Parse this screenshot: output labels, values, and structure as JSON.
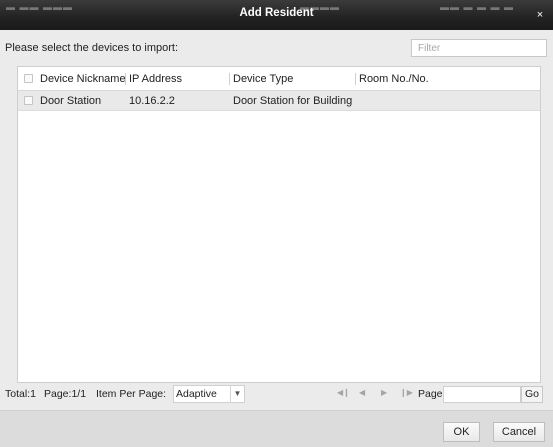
{
  "window": {
    "title": "Add Resident",
    "close_glyph": "×"
  },
  "prompt": "Please select the devices to import:",
  "filter": {
    "placeholder": "Filter",
    "value": ""
  },
  "table": {
    "columns": [
      "Device Nickname",
      "IP Address",
      "Device Type",
      "Room No./No."
    ],
    "rows": [
      {
        "nickname": "Door Station",
        "ip": "10.16.2.2",
        "type": "Door Station for Building",
        "room": ""
      }
    ]
  },
  "pagination": {
    "total": "Total:1",
    "page": "Page:1/1",
    "items_per_page_label": "Item Per Page:",
    "items_per_page_value": "Adaptive",
    "page_label": "Page",
    "page_value": "",
    "go_label": "Go",
    "first_icon": "first-page-icon",
    "prev_icon": "prev-page-icon",
    "next_icon": "next-page-icon",
    "last_icon": "last-page-icon"
  },
  "buttons": {
    "ok": "OK",
    "cancel": "Cancel"
  }
}
